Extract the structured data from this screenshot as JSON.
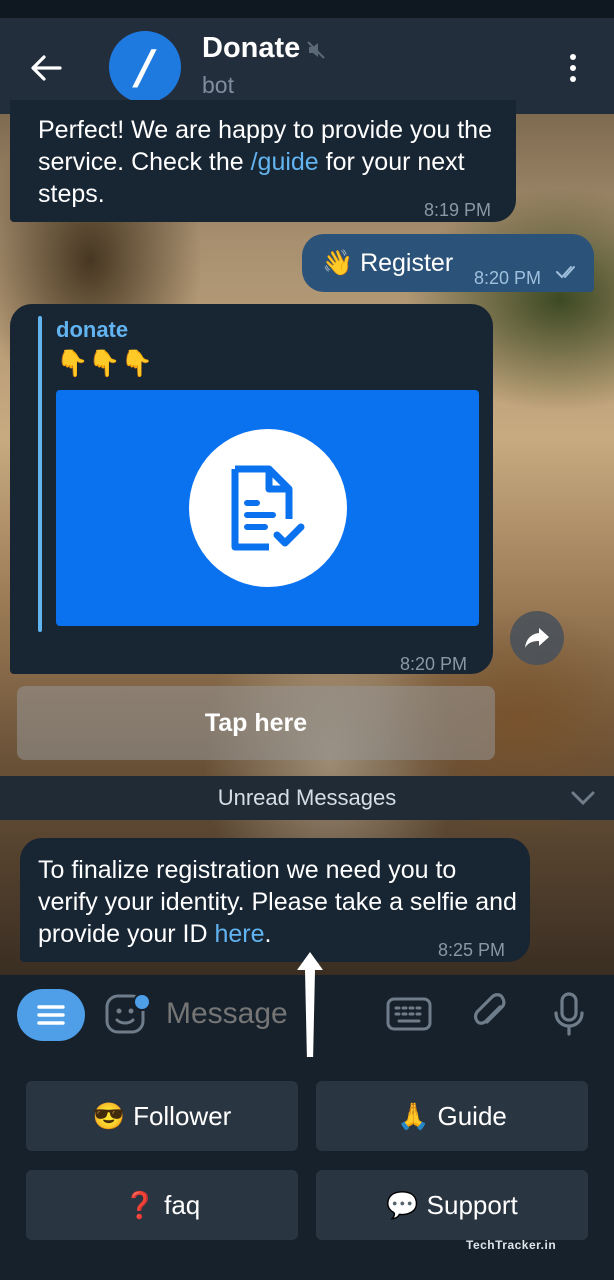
{
  "header": {
    "title": "Donate",
    "subtitle": "bot",
    "avatar_letter": "/"
  },
  "messages": [
    {
      "text_before": "Perfect! We are happy to provide you the service. Check the ",
      "link": "/guide",
      "text_after": " for your next steps.",
      "time": "8:19 PM"
    },
    {
      "text": "👋 Register",
      "time": "8:20 PM",
      "outgoing": true
    },
    {
      "reply_name": "donate",
      "reply_emoji": "👇👇👇",
      "time": "8:20 PM",
      "media_icon": "document-check-icon"
    },
    {
      "text_before": "To finalize registration we need you to verify your identity. Please take a selfie and provide your ID ",
      "link": "here",
      "text_after": ".",
      "time": "8:25 PM"
    }
  ],
  "inline_button": "Tap here",
  "unread_label": "Unread Messages",
  "input": {
    "placeholder": "Message"
  },
  "keyboard": [
    {
      "emoji": "😎",
      "label": "Follower"
    },
    {
      "emoji": "🙏",
      "label": "Guide"
    },
    {
      "emoji": "❓",
      "label": "faq"
    },
    {
      "emoji": "💬",
      "label": "Support"
    }
  ],
  "watermark": "TechTracker.in",
  "colors": {
    "accent": "#62b4f0",
    "header": "#232e3c",
    "outgoing_bubble": "#2b5278",
    "incoming_bubble": "#182533",
    "media": "#0a72ef"
  }
}
